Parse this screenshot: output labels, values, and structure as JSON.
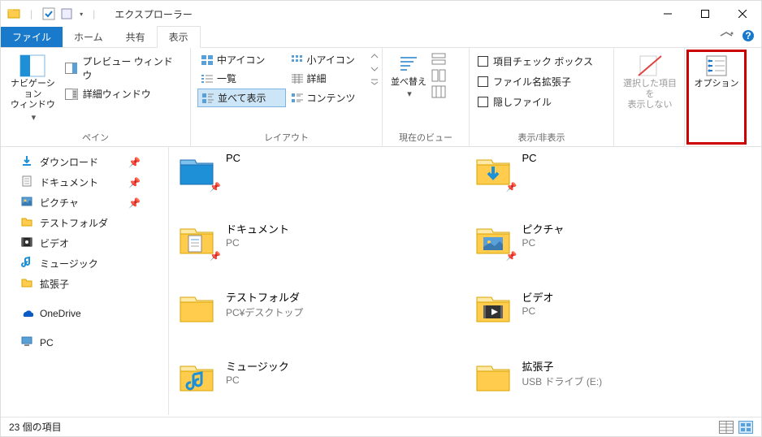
{
  "title": "エクスプローラー",
  "tabs": {
    "file": "ファイル",
    "home": "ホーム",
    "share": "共有",
    "view": "表示"
  },
  "groups": {
    "panes": {
      "label": "ペイン",
      "nav": "ナビゲーション\nウィンドウ",
      "preview": "プレビュー ウィンドウ",
      "details": "詳細ウィンドウ"
    },
    "layout": {
      "label": "レイアウト",
      "medium": "中アイコン",
      "small": "小アイコン",
      "list": "一覧",
      "details": "詳細",
      "tiles": "並べて表示",
      "content": "コンテンツ"
    },
    "currentview": {
      "label": "現在のビュー",
      "sort": "並べ替え"
    },
    "showhide": {
      "label": "表示/非表示",
      "checkboxes": "項目チェック ボックス",
      "extensions": "ファイル名拡張子",
      "hidden": "隠しファイル"
    },
    "select": {
      "label": "",
      "btn": "選択した項目を\n表示しない"
    },
    "options": {
      "label": "",
      "btn": "オプション"
    }
  },
  "tree": [
    {
      "icon": "download",
      "label": "ダウンロード",
      "pin": true
    },
    {
      "icon": "document",
      "label": "ドキュメント",
      "pin": true
    },
    {
      "icon": "pictures",
      "label": "ピクチャ",
      "pin": true
    },
    {
      "icon": "folder",
      "label": "テストフォルダ"
    },
    {
      "icon": "video",
      "label": "ビデオ"
    },
    {
      "icon": "music",
      "label": "ミュージック"
    },
    {
      "icon": "folder",
      "label": "拡張子"
    },
    {
      "icon": "onedrive",
      "label": "OneDrive",
      "top": true
    },
    {
      "icon": "pc",
      "label": "PC",
      "top": true
    }
  ],
  "files": [
    {
      "icon": "folder-blue",
      "name": "PC",
      "sub": "",
      "pin": true
    },
    {
      "icon": "download-folder",
      "name": "PC",
      "sub": "",
      "pin": true
    },
    {
      "icon": "document-folder",
      "name": "ドキュメント",
      "sub": "PC",
      "pin": true
    },
    {
      "icon": "pictures-folder",
      "name": "ピクチャ",
      "sub": "PC",
      "pin": true
    },
    {
      "icon": "folder",
      "name": "テストフォルダ",
      "sub": "PC¥デスクトップ"
    },
    {
      "icon": "video-folder",
      "name": "ビデオ",
      "sub": "PC"
    },
    {
      "icon": "music-folder",
      "name": "ミュージック",
      "sub": "PC"
    },
    {
      "icon": "folder",
      "name": "拡張子",
      "sub": "USB ドライブ (E:)"
    }
  ],
  "status": {
    "count": "23 個の項目"
  }
}
